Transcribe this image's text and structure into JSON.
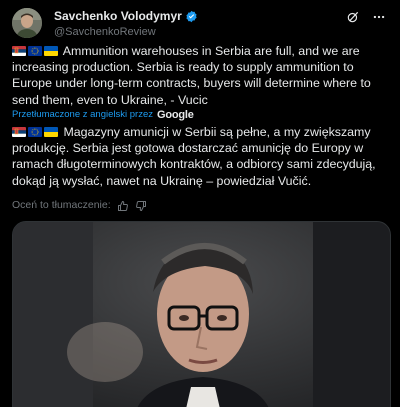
{
  "author": {
    "display_name": "Savchenko Volodymyr",
    "handle": "@SavchenkoReview",
    "verified": true
  },
  "header_icons": [
    "grok-icon",
    "more-icon"
  ],
  "post": {
    "text_en": "Ammunition warehouses in Serbia are full, and we are increasing production. Serbia is ready to supply ammunition to Europe under long-term contracts, buyers will determine where to send them, even to Ukraine, - Vucic",
    "translated_label": "Przetłumaczone z angielski przez",
    "translator": "Google",
    "text_pl": "Magazyny amunicji w Serbii są pełne, a my zwiększamy produkcję. Serbia jest gotowa dostarczać amunicję do Europy w ramach długoterminowych kontraktów, a odbiorcy sami zdecydują, dokąd ją wysłać, nawet na Ukrainę – powiedział Vučić.",
    "flags": [
      "serbia-flag-icon",
      "eu-flag-icon",
      "ukraine-flag-icon"
    ]
  },
  "rate_translation": {
    "label": "Oceń to tłumaczenie:"
  },
  "colors": {
    "background": "#000000",
    "text": "#e7e9ea",
    "muted": "#71767b",
    "link": "#1d9bf0"
  }
}
